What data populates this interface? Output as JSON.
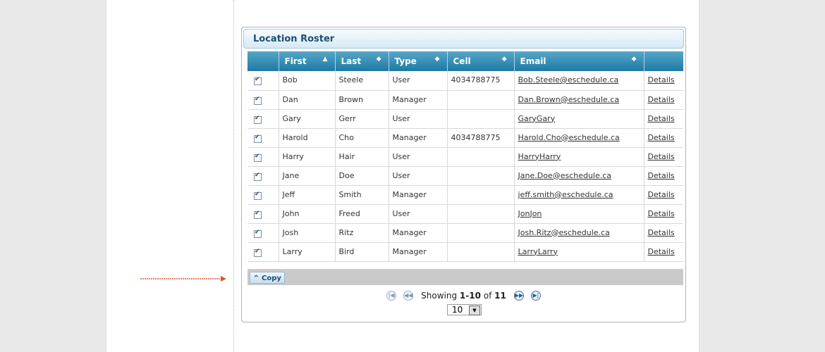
{
  "panel": {
    "title": "Location Roster"
  },
  "columns": [
    {
      "label": "",
      "sort_icon": ""
    },
    {
      "label": "First",
      "sort_icon": "▲"
    },
    {
      "label": "Last",
      "sort_icon": "◆"
    },
    {
      "label": "Type",
      "sort_icon": "◆"
    },
    {
      "label": "Cell",
      "sort_icon": "◆"
    },
    {
      "label": "Email",
      "sort_icon": "◆"
    },
    {
      "label": "",
      "sort_icon": ""
    }
  ],
  "rows": [
    {
      "checked": true,
      "first": "Bob",
      "last": "Steele",
      "type": "User",
      "cell": "4034788775",
      "email": "Bob.Steele@eschedule.ca",
      "action": "Details"
    },
    {
      "checked": true,
      "first": "Dan",
      "last": "Brown",
      "type": "Manager",
      "cell": "",
      "email": "Dan.Brown@eschedule.ca",
      "action": "Details"
    },
    {
      "checked": true,
      "first": "Gary",
      "last": "Gerr",
      "type": "User",
      "cell": "",
      "email": "GaryGary",
      "action": "Details"
    },
    {
      "checked": true,
      "first": "Harold",
      "last": "Cho",
      "type": "Manager",
      "cell": "4034788775",
      "email": "Harold.Cho@eschedule.ca",
      "action": "Details"
    },
    {
      "checked": true,
      "first": "Harry",
      "last": "Hair",
      "type": "User",
      "cell": "",
      "email": "HarryHarry",
      "action": "Details"
    },
    {
      "checked": true,
      "first": "Jane",
      "last": "Doe",
      "type": "User",
      "cell": "",
      "email": "Jane.Doe@eschedule.ca",
      "action": "Details"
    },
    {
      "checked": true,
      "first": "Jeff",
      "last": "Smith",
      "type": "Manager",
      "cell": "",
      "email": "jeff.smith@eschedule.ca",
      "action": "Details"
    },
    {
      "checked": true,
      "first": "John",
      "last": "Freed",
      "type": "User",
      "cell": "",
      "email": "JonJon",
      "action": "Details"
    },
    {
      "checked": true,
      "first": "Josh",
      "last": "Ritz",
      "type": "Manager",
      "cell": "",
      "email": "Josh.Ritz@eschedule.ca",
      "action": "Details"
    },
    {
      "checked": true,
      "first": "Larry",
      "last": "Bird",
      "type": "Manager",
      "cell": "",
      "email": "LarryLarry",
      "action": "Details"
    }
  ],
  "toolbar": {
    "copy_label": "^ Copy"
  },
  "pager": {
    "showing_prefix": "Showing ",
    "range": "1-10",
    "of_text": " of ",
    "total": "11",
    "first_icon": "first-page-icon",
    "prev_icon": "prev-page-icon",
    "next_icon": "next-page-icon",
    "last_icon": "last-page-icon"
  },
  "page_size": {
    "selected": "10"
  },
  "colors": {
    "header": "#1e7aa3",
    "title": "#1c4f72",
    "arrow": "#e0533c"
  }
}
